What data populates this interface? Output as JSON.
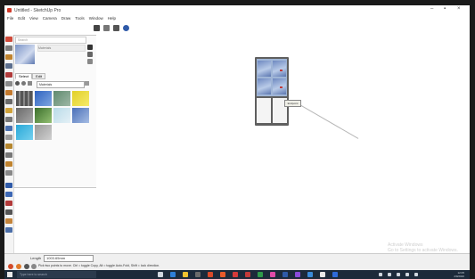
{
  "window": {
    "title": "Untitled - SketchUp Pro"
  },
  "menu": [
    "File",
    "Edit",
    "View",
    "Camera",
    "Draw",
    "Tools",
    "Window",
    "Help"
  ],
  "panel": {
    "search_placeholder": "Search",
    "preview_name": "Materials",
    "tabs": [
      "Select",
      "Edit"
    ],
    "library": "Materials"
  },
  "viewport": {
    "tooltip": "Endpoint",
    "watermark_line1": "Activate Windows",
    "watermark_line2": "Go to Settings to activate Windows."
  },
  "status": {
    "measure_label": "Length",
    "measure_value": "1003.65mm",
    "hint": "Pick two points to move. Ctrl = toggle Copy, Alt = toggle Auto-Fold, Shift = lock direction."
  },
  "taskbar": {
    "search_placeholder": "Type here to search",
    "time": "12:05",
    "date": "2/9/2020"
  },
  "colors": {
    "accent_blue": "#2f5aa8",
    "glass_blue": "#9fb5d6",
    "taskbar": "#1c2a3a"
  }
}
